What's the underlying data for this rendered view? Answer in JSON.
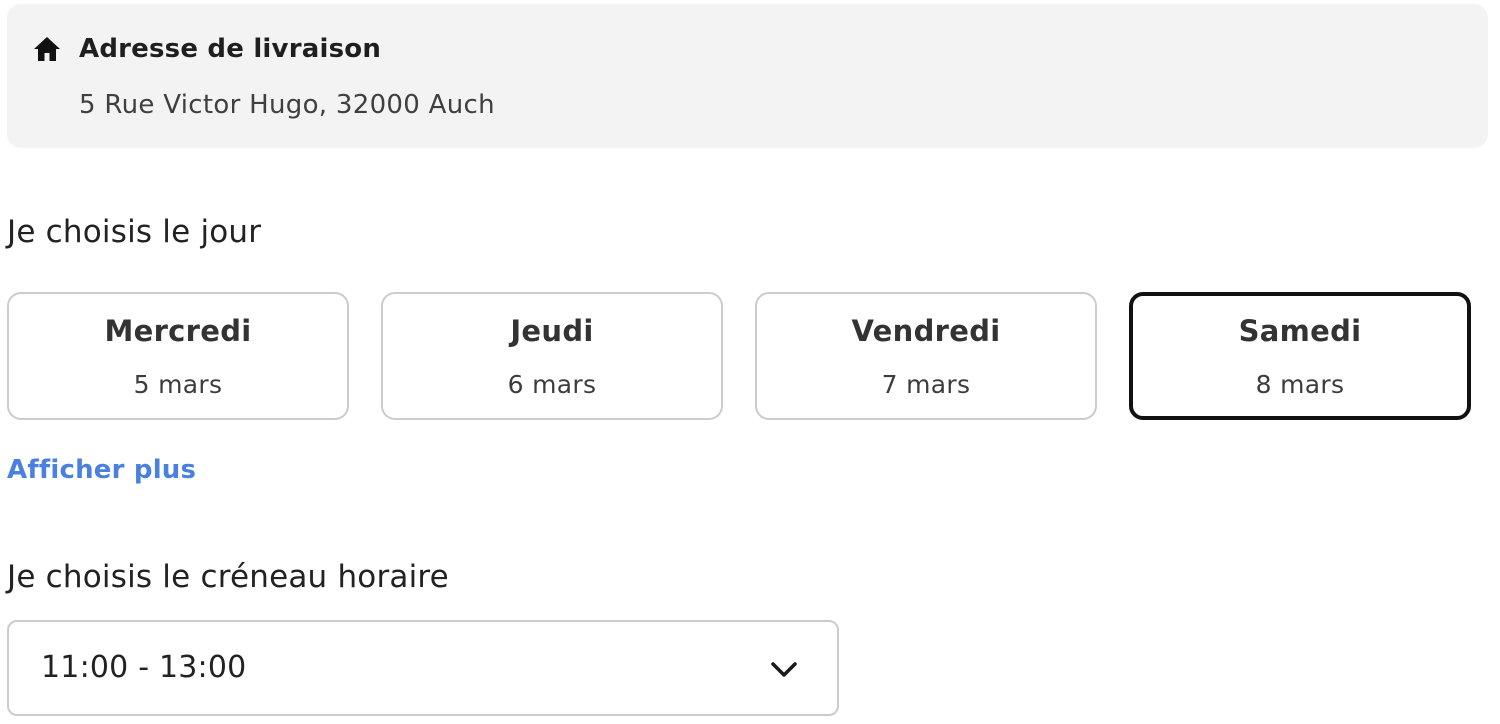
{
  "address": {
    "icon": "home-icon",
    "title": "Adresse de livraison",
    "line": "5 Rue Victor Hugo, 32000 Auch"
  },
  "day_section": {
    "title": "Je choisis le jour",
    "days": [
      {
        "name": "Mercredi",
        "date": "5 mars",
        "selected": false
      },
      {
        "name": "Jeudi",
        "date": "6 mars",
        "selected": false
      },
      {
        "name": "Vendredi",
        "date": "7 mars",
        "selected": false
      },
      {
        "name": "Samedi",
        "date": "8 mars",
        "selected": true
      }
    ],
    "show_more": "Afficher plus"
  },
  "slot_section": {
    "title": "Je choisis le créneau horaire",
    "selected_value": "11:00 - 13:00",
    "icon": "chevron-down-icon"
  },
  "colors": {
    "card_background": "#f3f3f3",
    "link": "#4a80e0",
    "selected_border": "#111111",
    "border": "#cccccc"
  }
}
